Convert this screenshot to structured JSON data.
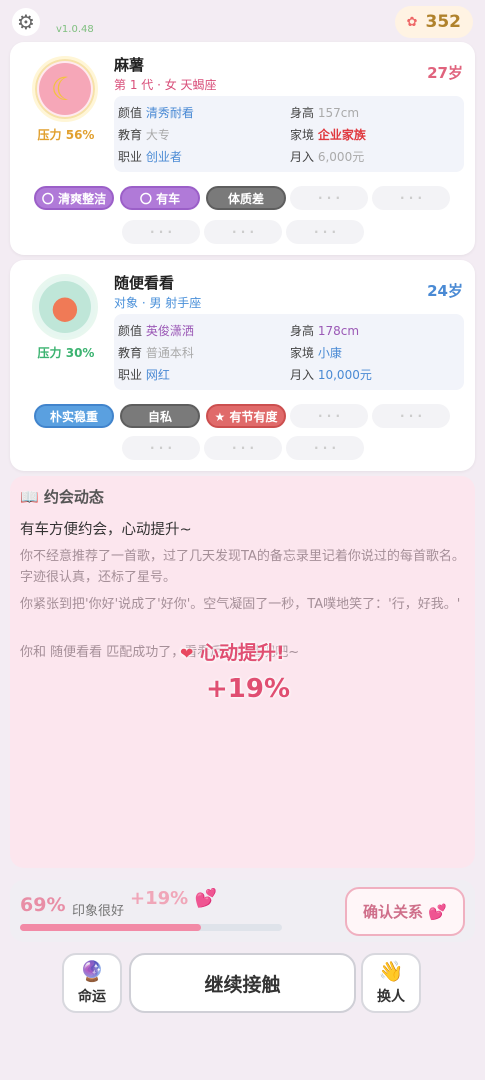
{
  "topbar": {
    "version": "v1.0.48",
    "coins": "352"
  },
  "card1": {
    "name": "麻薯",
    "subtitle": "第 1 代 · 女 天蝎座",
    "age": "27岁",
    "pressure": "压力 56%",
    "info": {
      "looks_label": "颜值",
      "looks_value": "清秀耐看",
      "height_label": "身高",
      "height_value": "157cm",
      "edu_label": "教育",
      "edu_value": "大专",
      "family_label": "家境",
      "family_value": "企业家族",
      "job_label": "职业",
      "job_value": "创业者",
      "income_label": "月入",
      "income_value": "6,000元"
    },
    "tags": [
      "〇 清爽整洁",
      "〇 有车",
      "体质差",
      "· · ·",
      "· · ·",
      "· · ·",
      "· · ·",
      "· · ·"
    ]
  },
  "card2": {
    "name": "随便看看",
    "subtitle": "对象 · 男 射手座",
    "age": "24岁",
    "pressure": "压力 30%",
    "info": {
      "looks_label": "颜值",
      "looks_value": "英俊潇洒",
      "height_label": "身高",
      "height_value": "178cm",
      "edu_label": "教育",
      "edu_value": "普通本科",
      "family_label": "家境",
      "family_value": "小康",
      "job_label": "职业",
      "job_value": "网红",
      "income_label": "月入",
      "income_value": "10,000元"
    },
    "tags": [
      "朴实稳重",
      "自私",
      "★ 有节有度",
      "· · ·",
      "· · ·",
      "· · ·",
      "· · ·",
      "· · ·"
    ]
  },
  "dating": {
    "title": "📖 约会动态",
    "lead": "有车方便约会，心动提升~",
    "p1": "你不经意推荐了一首歌，过了几天发现TA的备忘录里记着你说过的每首歌名。字迹很认真，还标了星号。",
    "p2": "你紧张到把'你好'说成了'好你'。空气凝固了一秒，TA噗地笑了：'行，好我。'",
    "p3": "你和 随便看看 匹配成功了，看看后续的情况吧~",
    "popup_title": "心动提升!",
    "popup_value": "+19%"
  },
  "impression": {
    "percent": "69%",
    "label": "印象很好",
    "gain": "+19%",
    "progress": 0.69,
    "confirm_label": "确认关系"
  },
  "actions": {
    "fate_label": "命运",
    "continue_label": "继续接触",
    "swap_label": "换人"
  },
  "colors": {
    "accent_pink": "#e04f72",
    "purple_tag": "#b07ad8",
    "blue_tag": "#5aa0e0",
    "red_tag": "#e06a6a"
  }
}
